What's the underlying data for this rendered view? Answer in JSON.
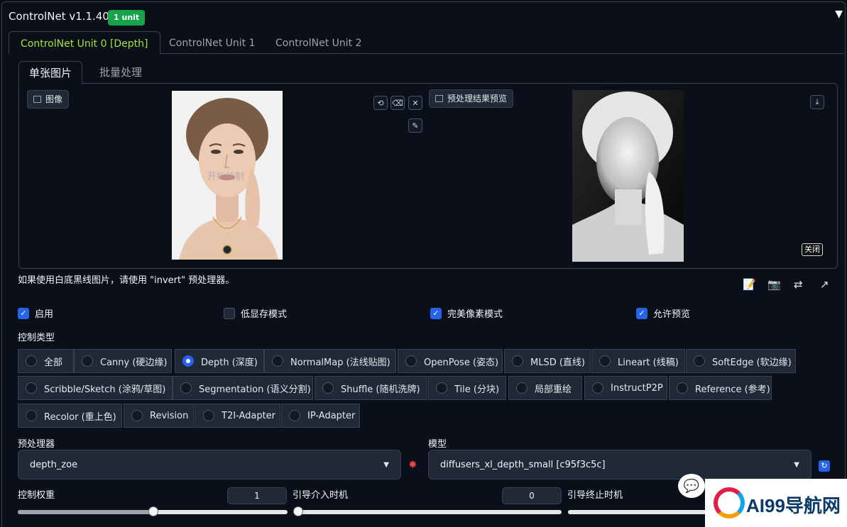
{
  "header": {
    "title": "ControlNet v1.1.405",
    "badge": "1 unit",
    "collapse_glyph": "▼"
  },
  "unit_tabs": [
    {
      "label": "ControlNet Unit 0 [Depth]",
      "active": true
    },
    {
      "label": "ControlNet Unit 1",
      "active": false
    },
    {
      "label": "ControlNet Unit 2",
      "active": false
    }
  ],
  "image_tabs": [
    {
      "label": "单张图片",
      "active": true
    },
    {
      "label": "批量处理",
      "active": false
    }
  ],
  "image_panel": {
    "input_label": "图像",
    "start_draw": "开始绘制",
    "preview_label": "预处理结果预览",
    "close_label": "关闭",
    "buttons": {
      "undo": "⟲",
      "erase": "⌫",
      "clear": "✕",
      "brush": "✎",
      "download": "⤓"
    }
  },
  "hint": "如果使用白底黑线图片，请使用 \"invert\" 预处理器。",
  "toolbar_icons": [
    "edit-icon",
    "camera-icon",
    "swap-icon",
    "send-icon"
  ],
  "checkboxes": [
    {
      "label": "启用",
      "checked": true
    },
    {
      "label": "低显存模式",
      "checked": false
    },
    {
      "label": "完美像素模式",
      "checked": true
    },
    {
      "label": "允许预览",
      "checked": true
    }
  ],
  "control_type": {
    "label": "控制类型",
    "options": [
      {
        "label": "全部",
        "selected": false
      },
      {
        "label": "Canny (硬边缘)",
        "selected": false
      },
      {
        "label": "Depth (深度)",
        "selected": true
      },
      {
        "label": "NormalMap (法线贴图)",
        "selected": false
      },
      {
        "label": "OpenPose (姿态)",
        "selected": false
      },
      {
        "label": "MLSD (直线)",
        "selected": false
      },
      {
        "label": "Lineart (线稿)",
        "selected": false
      },
      {
        "label": "SoftEdge (软边缘)",
        "selected": false
      },
      {
        "label": "Scribble/Sketch (涂鸦/草图)",
        "selected": false
      },
      {
        "label": "Segmentation (语义分割)",
        "selected": false
      },
      {
        "label": "Shuffle (随机洗牌)",
        "selected": false
      },
      {
        "label": "Tile (分块)",
        "selected": false
      },
      {
        "label": "局部重绘",
        "selected": false
      },
      {
        "label": "InstructP2P",
        "selected": false
      },
      {
        "label": "Reference (参考)",
        "selected": false
      },
      {
        "label": "Recolor (重上色)",
        "selected": false
      },
      {
        "label": "Revision",
        "selected": false
      },
      {
        "label": "T2I-Adapter",
        "selected": false
      },
      {
        "label": "IP-Adapter",
        "selected": false
      }
    ]
  },
  "preprocessor": {
    "label": "预处理器",
    "value": "depth_zoe"
  },
  "model": {
    "label": "模型",
    "value": "diffusers_xl_depth_small [c95f3c5c]"
  },
  "control_weight": {
    "label": "控制权重",
    "value": "1",
    "fraction": 0.5
  },
  "guidance_start": {
    "label": "引导介入时机",
    "value": "0",
    "fraction": 0
  },
  "guidance_end": {
    "label": "引导终止时机"
  },
  "watermark": {
    "text": "AI99导航网"
  },
  "colors": {
    "accent_green": "#a3e635",
    "badge_green": "#16a34a",
    "check_blue": "#2563eb",
    "bg": "#0b0f19"
  }
}
